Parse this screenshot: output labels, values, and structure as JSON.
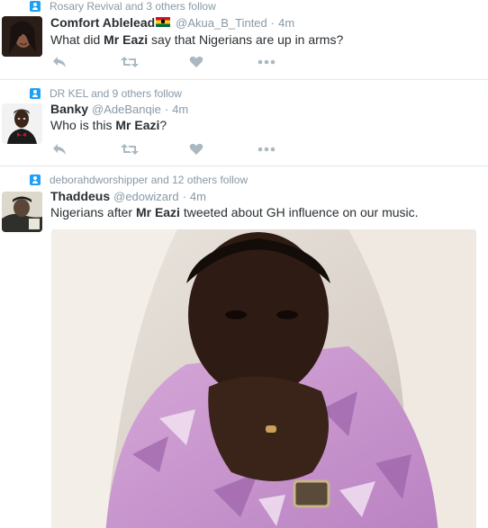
{
  "tweets": [
    {
      "context": "Rosary Revival and 3 others follow",
      "name": "Comfort Ablelead",
      "handle": "@Akua_B_Tinted",
      "time": "4m",
      "text_before": "What did ",
      "text_bold": "Mr Eazi",
      "text_after": " say that Nigerians are up in arms?"
    },
    {
      "context": "DR KEL and 9 others follow",
      "name": "Banky",
      "handle": "@AdeBanqie",
      "time": "4m",
      "text_before": "Who is this ",
      "text_bold": "Mr Eazi",
      "text_after": "?"
    },
    {
      "context": "deborahdworshipper and 12 others follow",
      "name": "Thaddeus",
      "handle": "@edowizard",
      "time": "4m",
      "text_before": "Nigerians after ",
      "text_bold": "Mr Eazi",
      "text_after": " tweeted about GH influence on our music."
    }
  ],
  "separator": "·",
  "colors": {
    "accent": "#1da1f2",
    "meta_gray": "#8899a6",
    "action_gray": "#aab8c2",
    "text": "#292f33",
    "divider": "#e1e8ed"
  },
  "icons": {
    "follow": "follow-context-icon",
    "reply": "reply-icon",
    "retweet": "retweet-icon",
    "like": "heart-icon",
    "more": "more-dots-icon"
  }
}
